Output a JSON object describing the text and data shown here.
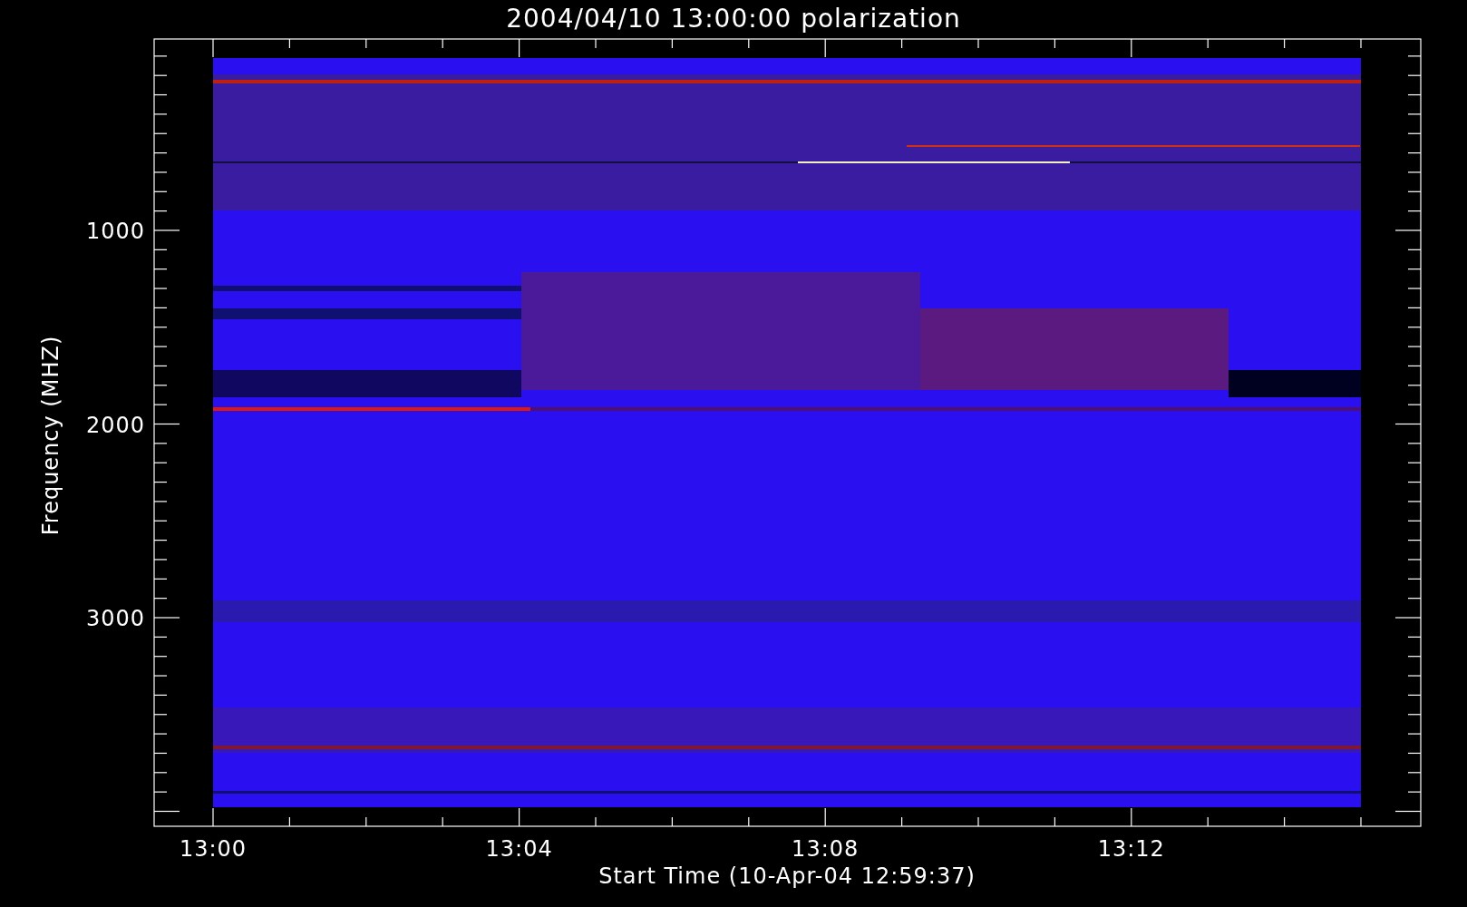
{
  "title": "2004/04/10 13:00:00 polarization",
  "x_axis": {
    "label": "Start Time (10-Apr-04 12:59:37)",
    "ticks": [
      "13:00",
      "13:04",
      "13:08",
      "13:12"
    ]
  },
  "y_axis": {
    "label": "Frequency (MHZ)",
    "ticks": [
      "1000",
      "2000",
      "3000"
    ]
  }
}
